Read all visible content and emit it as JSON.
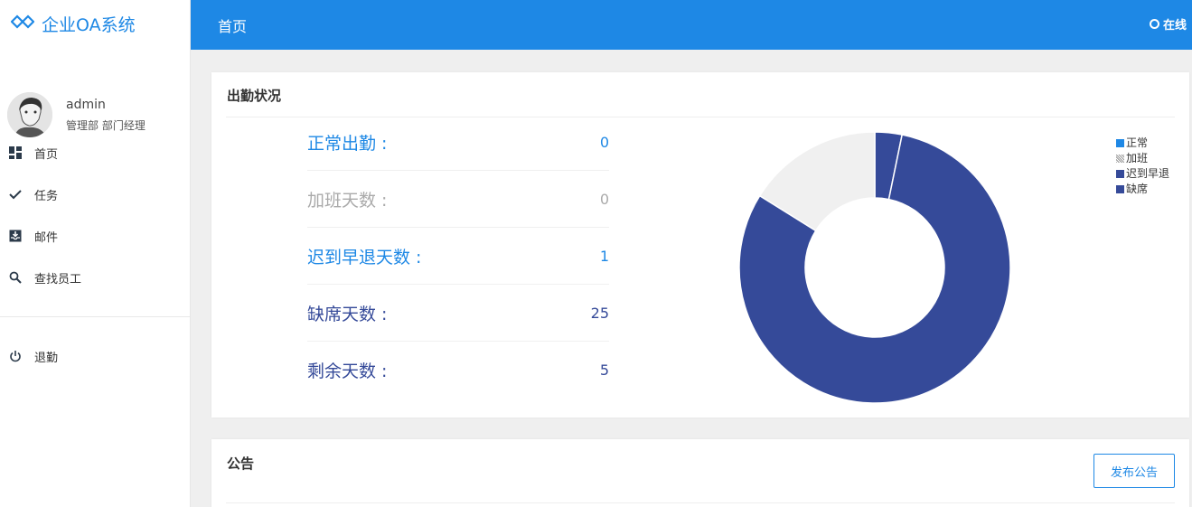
{
  "brand": {
    "title": "企业OA系统",
    "color": "#1e88e5"
  },
  "user": {
    "name": "admin",
    "role": "管理部 部门经理"
  },
  "nav": {
    "items": [
      {
        "label": "首页",
        "icon": "dashboard-icon"
      },
      {
        "label": "任务",
        "icon": "check-icon"
      },
      {
        "label": "邮件",
        "icon": "inbox-icon"
      },
      {
        "label": "查找员工",
        "icon": "search-icon"
      }
    ],
    "logout": {
      "label": "退勤",
      "icon": "power-icon"
    }
  },
  "header": {
    "title": "首页",
    "status": "在线"
  },
  "attendance": {
    "title": "出勤状况",
    "stats": [
      {
        "label": "正常出勤 :",
        "value": "0",
        "color": "#1e88e5"
      },
      {
        "label": "加班天数 :",
        "value": "0",
        "color": "#aaaaaa"
      },
      {
        "label": "迟到早退天数 :",
        "value": "1",
        "color": "#1e88e5"
      },
      {
        "label": "缺席天数 :",
        "value": "25",
        "color": "#354a99"
      },
      {
        "label": "剩余天数 :",
        "value": "5",
        "color": "#354a99"
      }
    ]
  },
  "chart_data": {
    "type": "pie",
    "donut": true,
    "categories": [
      "正常",
      "加班",
      "迟到早退",
      "缺席",
      "剩余"
    ],
    "values": [
      0,
      0,
      1,
      25,
      5
    ],
    "colors": [
      "#1e88e5",
      "#cccccc",
      "#354a99",
      "#354a99",
      "#f0f0f0"
    ],
    "legend": [
      "正常",
      "加班",
      "迟到早退",
      "缺席"
    ],
    "legend_placement": "top-right"
  },
  "notice": {
    "title": "公告",
    "button": "发布公告"
  }
}
